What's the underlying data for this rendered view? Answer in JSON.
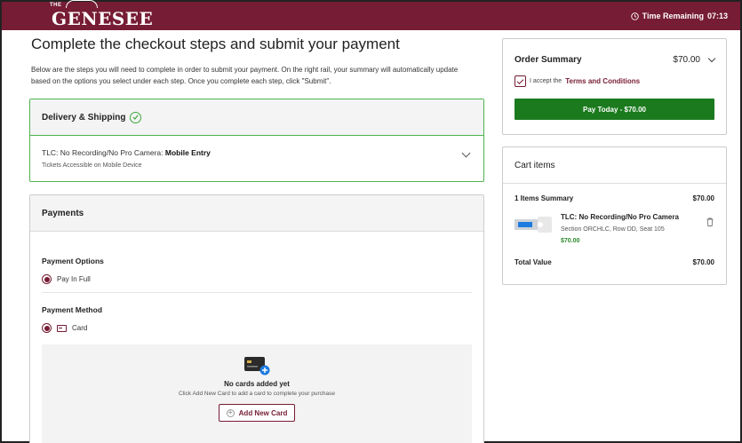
{
  "header": {
    "logo_small": "THE",
    "logo_text": "GENESEE",
    "timer_label": "Time Remaining",
    "timer_value": "07:13",
    "brand_color": "#761c34"
  },
  "main": {
    "title": "Complete the checkout steps and submit your payment",
    "intro": "Below are the steps you will need to complete in order to submit your payment. On the right rail, your summary will automatically update based on the options you select under each step. Once you complete each step, click \"Submit\"."
  },
  "delivery": {
    "title": "Delivery & Shipping",
    "option_prefix": "TLC: No Recording/No Pro Camera:",
    "option_bold": "Mobile Entry",
    "option_sub": "Tickets Accessible on Mobile Device"
  },
  "payments": {
    "title": "Payments",
    "options_label": "Payment Options",
    "options_selected": "Pay In Full",
    "method_label": "Payment Method",
    "method_selected": "Card",
    "no_cards_title": "No cards added yet",
    "no_cards_sub": "Click Add New Card to add a card to complete your purchase",
    "add_card_label": "Add New Card"
  },
  "order_summary": {
    "title": "Order Summary",
    "price": "$70.00",
    "terms_prefix": "I accept the",
    "terms_link": "Terms and Conditions",
    "pay_button": "Pay Today - $70.00",
    "pay_color": "#1b7a1e"
  },
  "cart": {
    "title": "Cart items",
    "summary_label": "1 Items Summary",
    "summary_price": "$70.00",
    "item_name": "TLC: No Recording/No Pro Camera",
    "item_seat": "Section ORCHLC, Row DD, Seat 105",
    "item_price": "$70.00",
    "total_label": "Total Value",
    "total_price": "$70.00"
  }
}
